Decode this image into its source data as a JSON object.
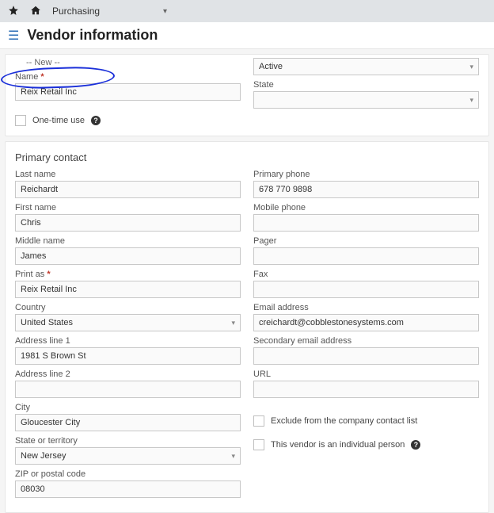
{
  "topbar": {
    "module": "Purchasing"
  },
  "page": {
    "title": "Vendor information"
  },
  "vendor": {
    "new_label": "-- New --",
    "name_label": "Name",
    "name_value": "Reix Retail Inc",
    "status_value": "Active",
    "state_label": "State",
    "one_time_label": "One-time use"
  },
  "contact": {
    "section_title": "Primary contact",
    "last_name_label": "Last name",
    "last_name": "Reichardt",
    "first_name_label": "First name",
    "first_name": "Chris",
    "middle_name_label": "Middle name",
    "middle_name": "James",
    "print_as_label": "Print as",
    "print_as": "Reix Retail Inc",
    "country_label": "Country",
    "country": "United States",
    "addr1_label": "Address line 1",
    "addr1": "1981 S Brown St",
    "addr2_label": "Address line 2",
    "addr2": "",
    "city_label": "City",
    "city": "Gloucester City",
    "state_label": "State or territory",
    "state": "New Jersey",
    "zip_label": "ZIP or postal code",
    "zip": "08030",
    "primary_phone_label": "Primary phone",
    "primary_phone": "678 770 9898",
    "mobile_label": "Mobile phone",
    "mobile": "",
    "pager_label": "Pager",
    "pager": "",
    "fax_label": "Fax",
    "fax": "",
    "email_label": "Email address",
    "email": "creichardt@cobblestonesystems.com",
    "sec_email_label": "Secondary email address",
    "sec_email": "",
    "url_label": "URL",
    "url": "",
    "exclude_label": "Exclude from the company contact list",
    "individual_label": "This vendor is an individual person"
  }
}
